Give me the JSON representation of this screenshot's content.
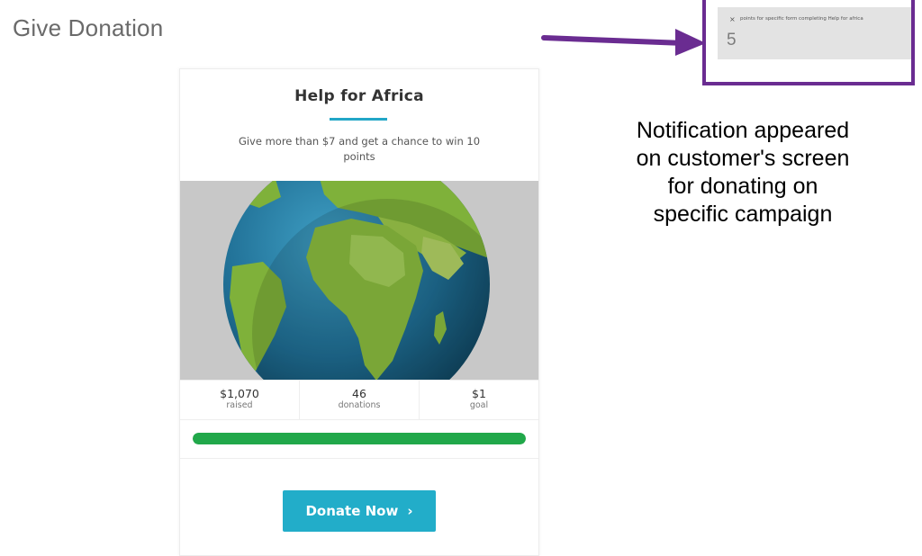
{
  "page": {
    "title": "Give Donation"
  },
  "campaign": {
    "title": "Help for Africa",
    "description": "Give more than $7 and get a chance to win 10 points",
    "stats": [
      {
        "value": "$1,070",
        "label": "raised"
      },
      {
        "value": "46",
        "label": "donations"
      },
      {
        "value": "$1",
        "label": "goal"
      }
    ],
    "progress_percent": 100,
    "donate_label": "Donate Now",
    "donate_icon": "chevron-right-icon",
    "accent_color": "#22adc9",
    "progress_color": "#21a84a"
  },
  "notification": {
    "close_symbol": "×",
    "text": "points for specific form completing Help for africa",
    "points": "5",
    "highlight_color": "#6a2c91"
  },
  "annotation": {
    "lines": [
      "Notification appeared",
      "on customer's screen",
      "for donating on",
      "specific campaign"
    ]
  }
}
